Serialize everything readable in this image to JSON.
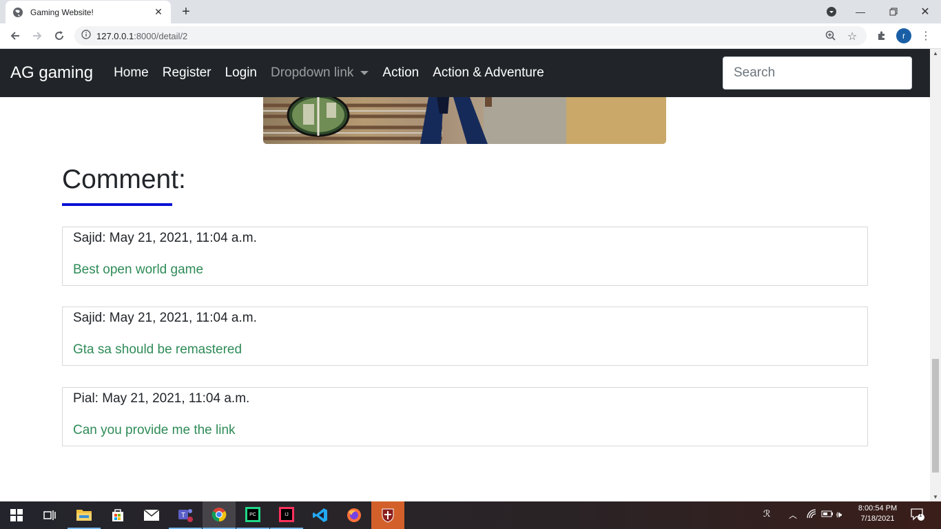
{
  "browser": {
    "tab_title": "Gaming Website!",
    "url_host": "127.0.0.1",
    "url_path": ":8000/detail/2",
    "profile_initial": "r"
  },
  "navbar": {
    "brand": "AG gaming",
    "links": [
      "Home",
      "Register",
      "Login",
      "Dropdown link",
      "Action",
      "Action & Adventure"
    ],
    "search_placeholder": "Search"
  },
  "comments_section": {
    "heading": "Comment:",
    "accent_color": "#0a12d6",
    "items": [
      {
        "meta": "Sajid: May 21, 2021, 11:04 a.m.",
        "body": "Best open world game"
      },
      {
        "meta": "Sajid: May 21, 2021, 11:04 a.m.",
        "body": "Gta sa should be remastered"
      },
      {
        "meta": "Pial: May 21, 2021, 11:04 a.m.",
        "body": "Can you provide me the link"
      }
    ]
  },
  "taskbar": {
    "time": "8:00:54 PM",
    "date": "7/18/2021",
    "notification_count": "1",
    "apps": [
      "start-icon",
      "task-view-icon",
      "file-explorer-icon",
      "store-icon",
      "mail-icon",
      "teams-icon",
      "chrome-icon",
      "pycharm-icon",
      "intellij-icon",
      "vscode-icon",
      "firefox-icon",
      "game-shield-icon"
    ]
  }
}
